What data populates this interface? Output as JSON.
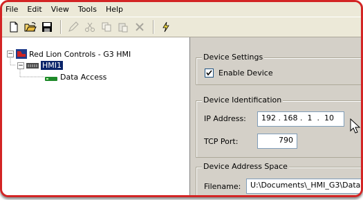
{
  "menu": [
    "File",
    "Edit",
    "View",
    "Tools",
    "Help"
  ],
  "toolbar": {
    "icons": [
      "new-icon",
      "open-icon",
      "save-icon",
      "pencil-icon",
      "cut-icon",
      "copy-icon",
      "paste-icon",
      "delete-icon",
      "lightning-icon"
    ]
  },
  "tree": {
    "root": "Red Lion Controls - G3 HMI",
    "device": "HMI1",
    "child": "Data Access"
  },
  "device_settings": {
    "legend": "Device Settings",
    "enable_label": "Enable Device",
    "enabled": true
  },
  "device_identification": {
    "legend": "Device Identification",
    "ip_label": "IP Address:",
    "ip_value": "192 . 168 .  1  .  10",
    "tcp_label": "TCP Port:",
    "tcp_value": "790"
  },
  "address_space": {
    "legend": "Device Address Space",
    "filename_label": "Filename:",
    "filename_value": "U:\\Documents\\_HMI_G3\\Data"
  },
  "colors": {
    "frame": "#d32424",
    "selection": "#0a246a",
    "chrome": "#d4d0c8"
  }
}
